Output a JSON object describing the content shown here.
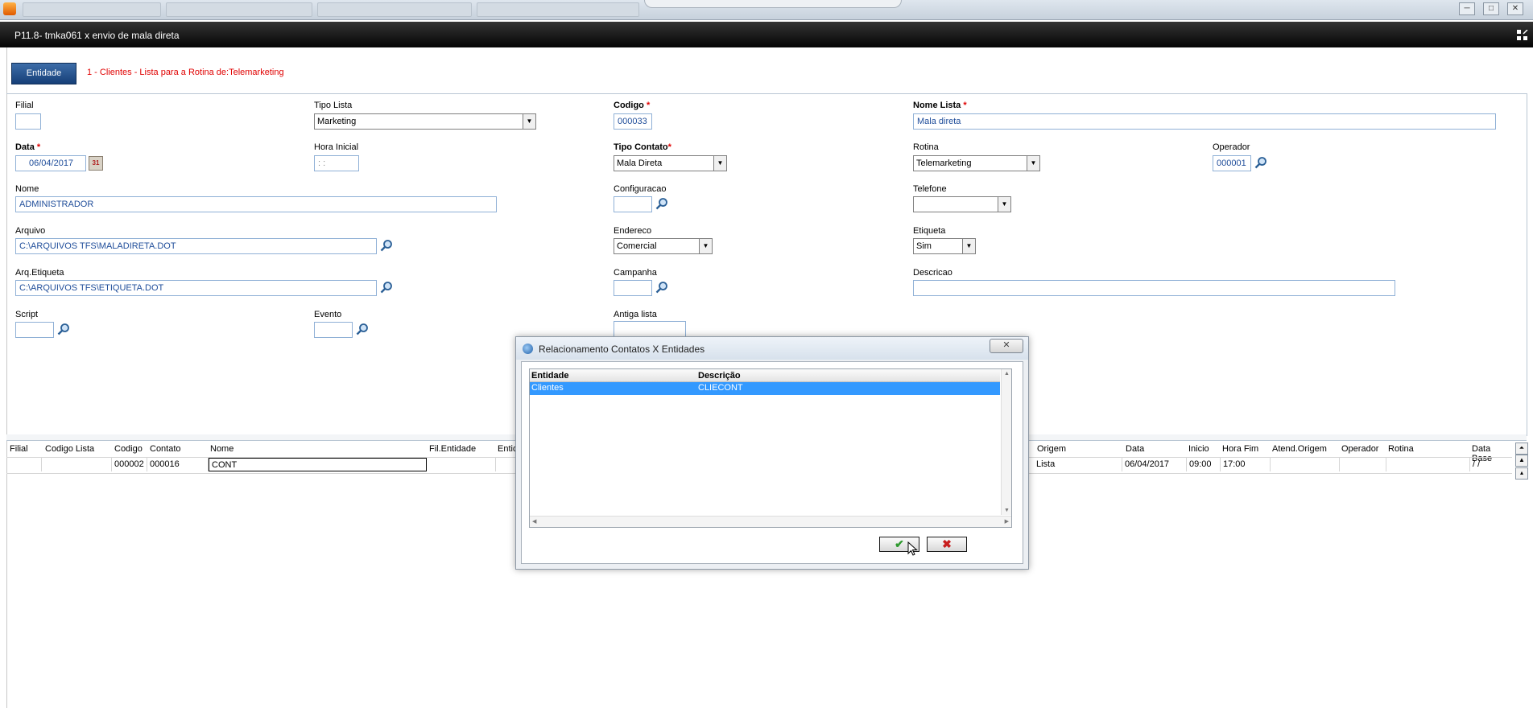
{
  "window": {
    "title": "P11.8- tmka061 x envio de mala direta",
    "controls": [
      "─",
      "□",
      "✕"
    ]
  },
  "entity_bar": {
    "button_label": "Entidade",
    "description": "1 - Clientes - Lista para a Rotina de:Telemarketing"
  },
  "form": {
    "filial": {
      "label": "Filial",
      "value": ""
    },
    "tipo_lista": {
      "label": "Tipo Lista",
      "value": "Marketing"
    },
    "codigo": {
      "label": "Codigo",
      "required": "*",
      "value": "000033"
    },
    "nome_lista": {
      "label": "Nome Lista",
      "required": "*",
      "value": "Mala direta"
    },
    "data": {
      "label": "Data",
      "required": "*",
      "value": "06/04/2017",
      "calendar_icon_text": "31"
    },
    "hora_inicial": {
      "label": "Hora Inicial",
      "value": " : :"
    },
    "tipo_contato": {
      "label": "Tipo Contato",
      "required": "*",
      "value": "Mala Direta"
    },
    "rotina": {
      "label": "Rotina",
      "value": "Telemarketing"
    },
    "operador": {
      "label": "Operador",
      "value": "000001"
    },
    "nome": {
      "label": "Nome",
      "value": "ADMINISTRADOR"
    },
    "configuracao": {
      "label": "Configuracao",
      "value": ""
    },
    "telefone": {
      "label": "Telefone",
      "value": ""
    },
    "arquivo": {
      "label": "Arquivo",
      "value": "C:\\ARQUIVOS TFS\\MALADIRETA.DOT"
    },
    "endereco": {
      "label": "Endereco",
      "value": "Comercial"
    },
    "etiqueta": {
      "label": "Etiqueta",
      "value": "Sim"
    },
    "arq_etiqueta": {
      "label": "Arq.Etiqueta",
      "value": "C:\\ARQUIVOS TFS\\ETIQUETA.DOT"
    },
    "campanha": {
      "label": "Campanha",
      "value": ""
    },
    "descricao": {
      "label": "Descricao",
      "value": ""
    },
    "script": {
      "label": "Script",
      "value": ""
    },
    "evento": {
      "label": "Evento",
      "value": ""
    },
    "antiga_lista": {
      "label": "Antiga lista",
      "value": ""
    }
  },
  "grid": {
    "columns": [
      "Filial",
      "Codigo Lista",
      "Codigo",
      "Contato",
      "Nome",
      "Fil.Entidade",
      "Entida",
      "Origem",
      "Data",
      "Inicio",
      "Hora Fim",
      "Atend.Origem",
      "Operador",
      "Rotina",
      "Data Base"
    ],
    "row": {
      "filial": "",
      "codigo_lista": "",
      "codigo": "000002",
      "contato": "000016",
      "nome": "CONT",
      "fil_entidade": "",
      "entidade": "",
      "origem": "Lista",
      "data": "06/04/2017",
      "inicio": "09:00",
      "hora_fim": "17:00",
      "atend_origem": "",
      "operador": "",
      "rotina": "",
      "data_base": " /  /"
    }
  },
  "dialog": {
    "title": "Relacionamento Contatos X Entidades",
    "close_label": "✕",
    "columns": [
      "Entidade",
      "Descrição"
    ],
    "rows": [
      {
        "entidade": "Clientes",
        "descricao": "CLIECONT"
      }
    ],
    "ok_icon": "✔",
    "cancel_icon": "✖"
  },
  "colors": {
    "title_bar": "#000000",
    "entity_button": "#1f4c86",
    "required_marker": "#e00000",
    "field_text": "#1f4d9a",
    "selection": "#3399ff"
  }
}
